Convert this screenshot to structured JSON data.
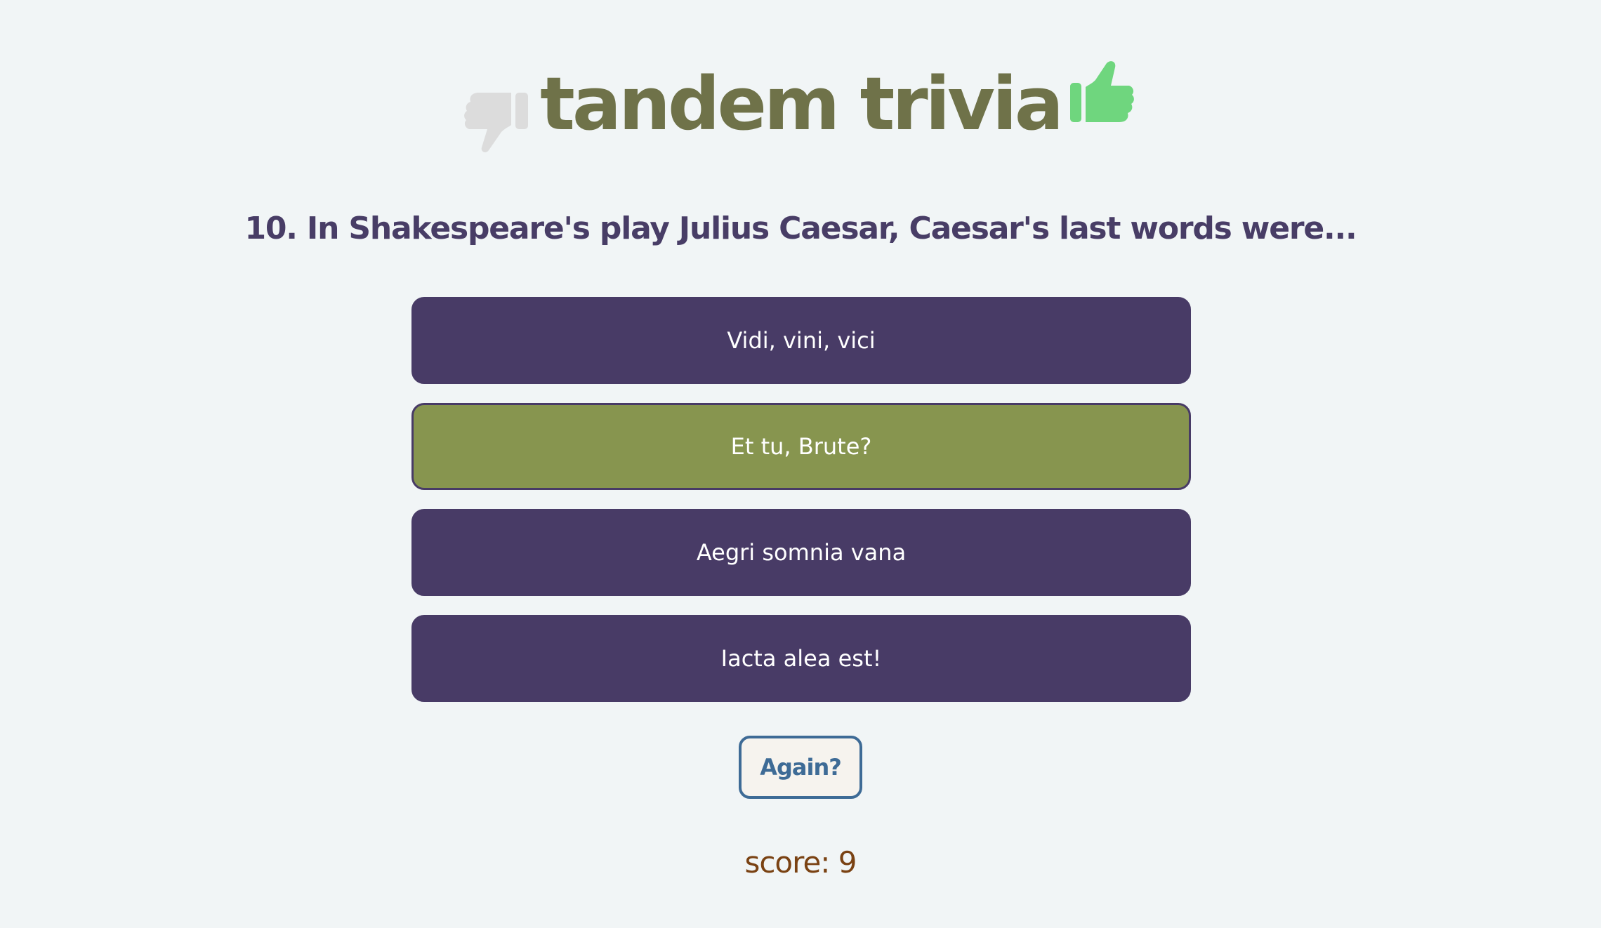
{
  "header": {
    "title": "tandem trivia",
    "thumb_down_icon": "thumbs-down-icon",
    "thumb_up_icon": "thumbs-up-icon",
    "thumb_down_color": "#dcdcdc",
    "thumb_up_color": "#6fd67e"
  },
  "question": {
    "text": "10. In Shakespeare's play Julius Caesar, Caesar's last words were..."
  },
  "answers": [
    {
      "label": "Vidi, vini, vici",
      "state": "default"
    },
    {
      "label": "Et tu, Brute?",
      "state": "correct"
    },
    {
      "label": "Aegri somnia vana",
      "state": "default"
    },
    {
      "label": "Iacta alea est!",
      "state": "default"
    }
  ],
  "again_button": {
    "label": "Again?"
  },
  "score": {
    "label": "score: 9"
  },
  "colors": {
    "background": "#f1f5f6",
    "answer_default": "#483b66",
    "answer_correct": "#87954f",
    "title": "#6f7249",
    "question": "#483d66",
    "again": "#3e6b96",
    "score": "#7a4213"
  }
}
